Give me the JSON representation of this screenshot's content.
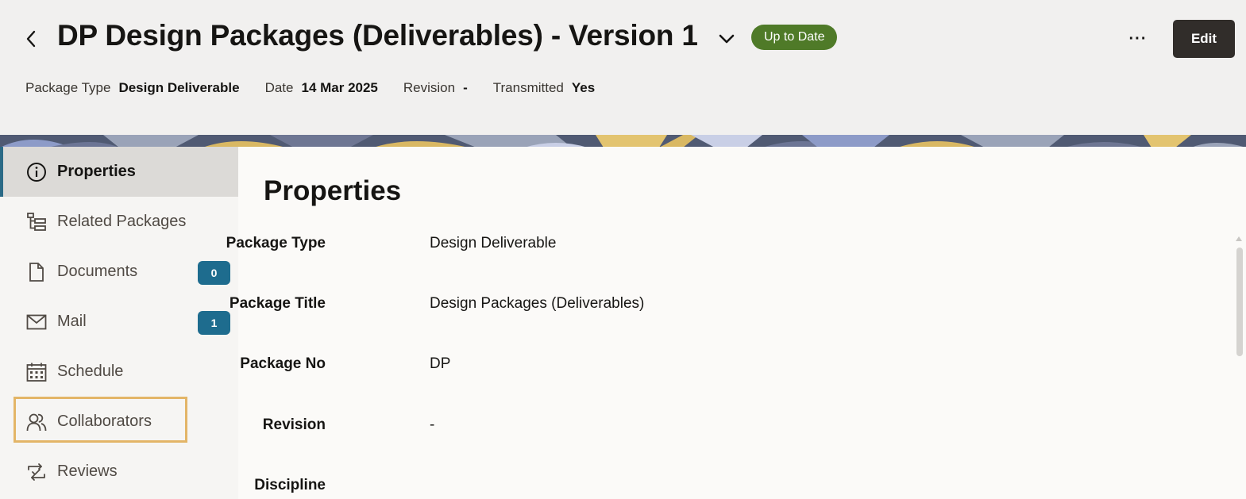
{
  "header": {
    "title": "DP Design Packages (Deliverables) - Version 1",
    "status": "Up to Date",
    "edit_label": "Edit",
    "more_label": "···",
    "meta": [
      {
        "label": "Package Type",
        "value": "Design Deliverable"
      },
      {
        "label": "Date",
        "value": "14 Mar 2025"
      },
      {
        "label": "Revision",
        "value": "-"
      },
      {
        "label": "Transmitted",
        "value": "Yes"
      }
    ]
  },
  "sidebar": {
    "items": [
      {
        "label": "Properties",
        "icon": "info-icon",
        "active": true
      },
      {
        "label": "Related Packages",
        "icon": "hierarchy-icon"
      },
      {
        "label": "Documents",
        "icon": "document-icon",
        "count": "0"
      },
      {
        "label": "Mail",
        "icon": "mail-icon",
        "count": "1"
      },
      {
        "label": "Schedule",
        "icon": "calendar-icon"
      },
      {
        "label": "Collaborators",
        "icon": "users-icon",
        "focused": true
      },
      {
        "label": "Reviews",
        "icon": "review-icon"
      }
    ]
  },
  "main": {
    "section_title": "Properties",
    "properties": [
      {
        "label": "Package Type",
        "value": "Design Deliverable"
      },
      {
        "label": "Package Title",
        "value": "Design Packages (Deliverables)"
      },
      {
        "label": "Package No",
        "value": "DP"
      },
      {
        "label": "Revision",
        "value": "-"
      },
      {
        "label": "Discipline",
        "value": ""
      }
    ]
  },
  "colors": {
    "status_badge": "#4f7a28",
    "edit_button": "#312d2a",
    "count_badge": "#1e6c8e",
    "active_indicator": "#2b6a86",
    "focus_outline": "#e3b567"
  }
}
